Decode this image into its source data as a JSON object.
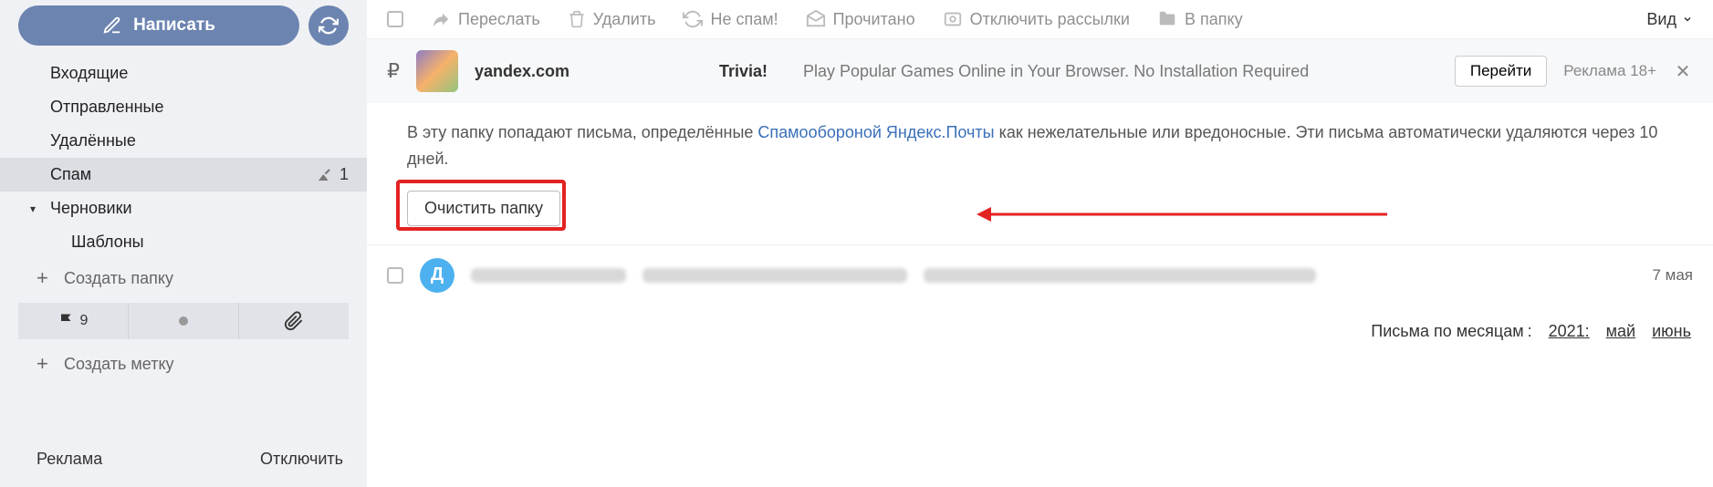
{
  "sidebar": {
    "compose_label": "Написать",
    "folders": [
      {
        "label": "Входящие"
      },
      {
        "label": "Отправленные"
      },
      {
        "label": "Удалённые"
      },
      {
        "label": "Спам",
        "count": "1",
        "active": true,
        "has_broom": true
      },
      {
        "label": "Черновики",
        "collapsible": true,
        "expanded": true
      },
      {
        "label": "Шаблоны",
        "sub": true
      }
    ],
    "create_folder": "Создать папку",
    "create_label": "Создать метку",
    "flag_count": "9",
    "ad_label": "Реклама",
    "ad_off": "Отключить"
  },
  "toolbar": {
    "actions": {
      "forward": "Переслать",
      "delete": "Удалить",
      "notspam": "Не спам!",
      "read": "Прочитано",
      "unsubscribe": "Отключить рассылки",
      "move": "В папку"
    },
    "view": "Вид"
  },
  "ad": {
    "sender": "yandex.com",
    "subject": "Trivia!",
    "text": "Play Popular Games Online in Your Browser. No Installation Required",
    "go": "Перейти",
    "tag": "Реклама 18+"
  },
  "info": {
    "text_before": "В эту папку попадают письма, определённые ",
    "link": "Спамообороной Яндекс.Почты",
    "text_after": " как нежелательные или вредоносные. Эти письма автоматически удаляются через 10 дней.",
    "clear": "Очистить папку"
  },
  "message": {
    "avatar_initial": "Д",
    "date": "7 мая"
  },
  "months": {
    "label": "Письма по месяцам",
    "year": "2021",
    "m1": "май",
    "m2": "июнь"
  }
}
